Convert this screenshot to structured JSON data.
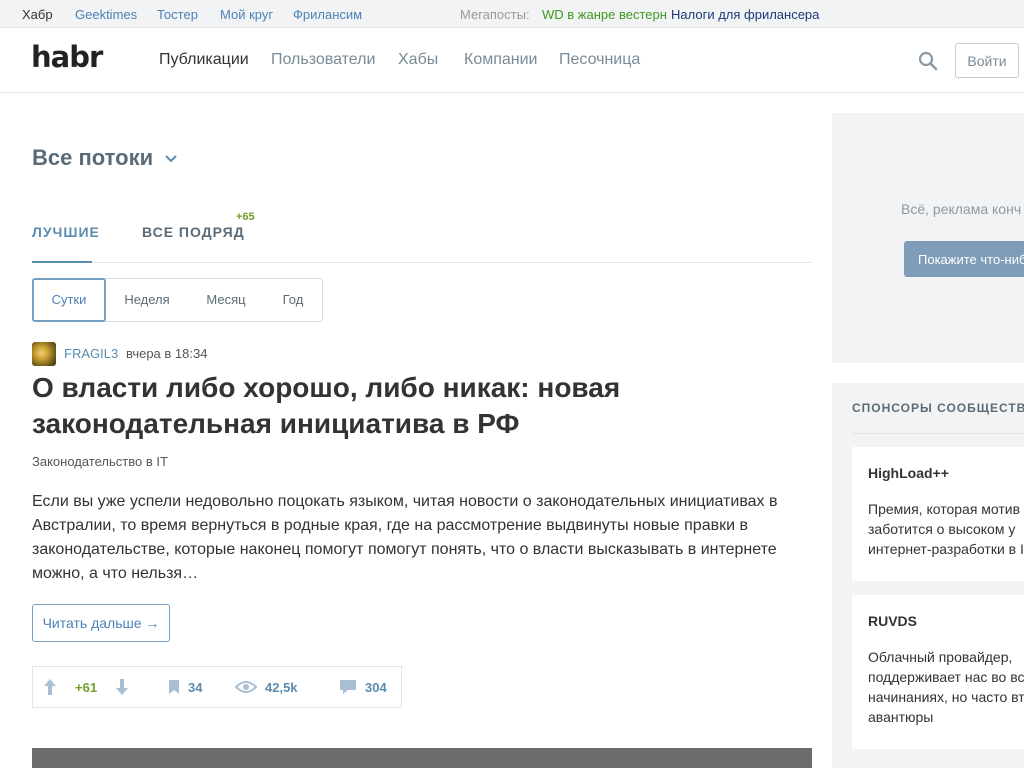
{
  "topbar": {
    "services": [
      "Хабр",
      "Geektimes",
      "Тостер",
      "Мой круг",
      "Фрилансим"
    ],
    "megaposts_label": "Мегапосты:",
    "megaposts": [
      "WD в жанре вестерн",
      "Налоги для фрилансера"
    ]
  },
  "header": {
    "logo": "habr",
    "nav": [
      "Публикации",
      "Пользователи",
      "Хабы",
      "Компании",
      "Песочница"
    ],
    "login": "Войти"
  },
  "feed": {
    "flows_title": "Все потоки",
    "tabs": {
      "best": "ЛУЧШИЕ",
      "all": "ВСЕ ПОДРЯД",
      "all_count": "+65"
    },
    "periods": [
      "Сутки",
      "Неделя",
      "Месяц",
      "Год"
    ]
  },
  "post": {
    "author": "FRAGIL3",
    "time": "вчера в 18:34",
    "title": "О власти либо хорошо, либо никак: новая законодательная инициатива в РФ",
    "hub": "Законодательство в IT",
    "excerpt": "Если вы уже успели недовольно поцокать языком, читая новости о законодательных инициативах в Австралии, то время вернуться в родные края, где на рассмотрение выдвинуты новые правки в законодательстве, которые наконец помогут помогут понять, что о власти высказывать в интернете можно, а что нельзя…",
    "read_more": "Читать дальше →",
    "score": "+61",
    "bookmarks": "34",
    "views": "42,5k",
    "comments": "304"
  },
  "sidebar": {
    "ad_text": "Всё, реклама конч",
    "ad_button": "Покажите что-ниб",
    "sponsors_title": "СПОНСОРЫ СООБЩЕСТВА",
    "sponsors": [
      {
        "name": "HighLoad++",
        "desc": "Премия, которая мотив и заботится о высоком у интернет-разработки в I"
      },
      {
        "name": "RUVDS",
        "desc": "Облачный провайдер, поддерживает нас во вс начинаниях, но часто вт в авантюры"
      }
    ]
  },
  "colors": {
    "accent": "#5a8cae",
    "positive": "#6da02b",
    "nav_muted": "#7a8b97"
  }
}
